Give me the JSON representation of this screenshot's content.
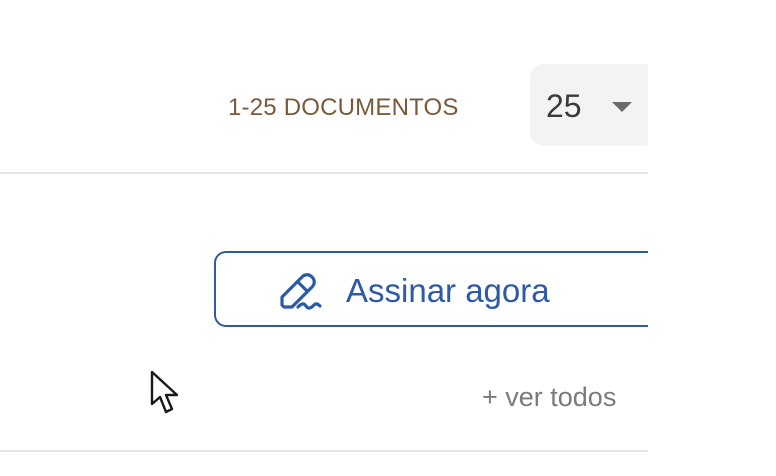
{
  "pagination": {
    "count_label": "1-25 DOCUMENTOS",
    "per_page_value": "25"
  },
  "actions": {
    "sign_now_label": "Assinar agora",
    "see_all_label": "+ ver todos"
  },
  "icons": {
    "sign": "pen-signature-icon",
    "dropdown": "caret-down-icon",
    "cursor": "mouse-pointer-icon"
  },
  "colors": {
    "accent": "#2c5aa6",
    "count_label": "#7a5a3a",
    "muted_text": "#7b7b7b",
    "divider": "#e6e6e6"
  }
}
